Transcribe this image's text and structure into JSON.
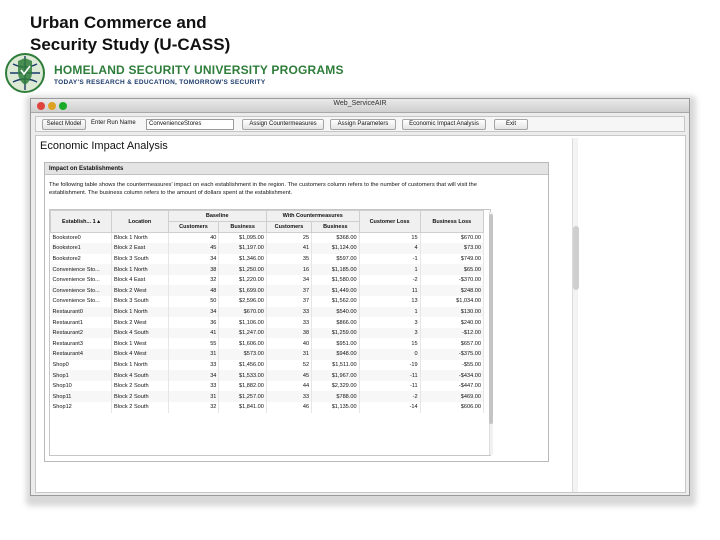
{
  "slide": {
    "title_line1": "Urban Commerce and",
    "title_line2": "Security Study (U-CASS)"
  },
  "logo": {
    "line1": "HOMELAND SECURITY UNIVERSITY PROGRAMS",
    "line2": "TODAY'S RESEARCH & EDUCATION, TOMORROW'S SECURITY",
    "icon": "globe-shield-icon"
  },
  "window": {
    "title": "Web_ServiceAIR",
    "toolbar": {
      "select_model": "Select Model",
      "run_name_label": "Enter Run Name",
      "run_name_value": "ConvenienceStores",
      "assign_countermeasures": "Assign Countermeasures",
      "assign_parameters": "Assign Parameters",
      "economic_impact": "Economic Impact Analysis",
      "exit": "Exit"
    }
  },
  "content": {
    "title": "Economic Impact Analysis",
    "panel_title": "Impact on Establishments",
    "description": "The following table shows the countermeasures' impact on each establishment in the region. The customers column refers to the number of customers that will visit the establishment. The business column refers to the amount of dollars spent at the establishment."
  },
  "table": {
    "group_headers": {
      "baseline": "Baseline",
      "with_countermeasures": "With Countermeasures"
    },
    "headers": {
      "establishment": "Establish...",
      "sort_indicator": "1 ▴",
      "location": "Location",
      "customers": "Customers",
      "business": "Business",
      "customer_loss": "Customer Loss",
      "business_loss": "Business Loss"
    },
    "rows": [
      [
        "Bookstore0",
        "Block 1 North",
        "40",
        "$1,095.00",
        "25",
        "$368.00",
        "15",
        "$670.00"
      ],
      [
        "Bookstore1",
        "Block 2 East",
        "45",
        "$1,197.00",
        "41",
        "$1,124.00",
        "4",
        "$73.00"
      ],
      [
        "Bookstore2",
        "Block 3 South",
        "34",
        "$1,346.00",
        "35",
        "$597.00",
        "-1",
        "$749.00"
      ],
      [
        "Convenience Sto...",
        "Block 1 North",
        "38",
        "$1,250.00",
        "16",
        "$1,185.00",
        "1",
        "$65.00"
      ],
      [
        "Convenience Sto...",
        "Block 4 East",
        "32",
        "$1,220.00",
        "34",
        "$1,580.00",
        "-2",
        "-$370.00"
      ],
      [
        "Convenience Sto...",
        "Block 2 West",
        "48",
        "$1,699.00",
        "37",
        "$1,449.00",
        "11",
        "$248.00"
      ],
      [
        "Convenience Sto...",
        "Block 3 South",
        "50",
        "$2,596.00",
        "37",
        "$1,562.00",
        "13",
        "$1,034.00"
      ],
      [
        "Restaurant0",
        "Block 1 North",
        "34",
        "$670.00",
        "33",
        "$540.00",
        "1",
        "$130.00"
      ],
      [
        "Restaurant1",
        "Block 2 West",
        "36",
        "$1,106.00",
        "33",
        "$866.00",
        "3",
        "$240.00"
      ],
      [
        "Restaurant2",
        "Block 4 South",
        "41",
        "$1,247.00",
        "38",
        "$1,259.00",
        "3",
        "-$12.00"
      ],
      [
        "Restaurant3",
        "Block 1 West",
        "55",
        "$1,606.00",
        "40",
        "$951.00",
        "15",
        "$657.00"
      ],
      [
        "Restaurant4",
        "Block 4 West",
        "31",
        "$573.00",
        "31",
        "$948.00",
        "0",
        "-$375.00"
      ],
      [
        "Shop0",
        "Block 1 North",
        "33",
        "$1,456.00",
        "52",
        "$1,511.00",
        "-19",
        "-$55.00"
      ],
      [
        "Shop1",
        "Block 4 South",
        "34",
        "$1,533.00",
        "45",
        "$1,967.00",
        "-11",
        "-$434.00"
      ],
      [
        "Shop10",
        "Block 2 South",
        "33",
        "$1,882.00",
        "44",
        "$2,329.00",
        "-11",
        "-$447.00"
      ],
      [
        "Shop11",
        "Block 2 South",
        "31",
        "$1,257.00",
        "33",
        "$788.00",
        "-2",
        "$469.00"
      ],
      [
        "Shop12",
        "Block 2 South",
        "32",
        "$1,841.00",
        "46",
        "$1,135.00",
        "-14",
        "$606.00"
      ]
    ]
  },
  "colors": {
    "logo_green": "#2e7d3a",
    "logo_navy": "#1b3a6b",
    "close_button": "#e0443e",
    "minimize_button": "#dea123",
    "zoom_button": "#1aab29"
  }
}
